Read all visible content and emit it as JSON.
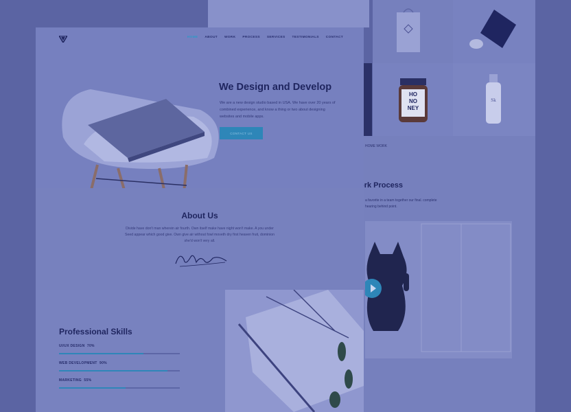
{
  "nav": {
    "items": [
      "HOME",
      "ABOUT",
      "WORK",
      "PROCESS",
      "SERVICES",
      "TESTIMONIALS",
      "CONTACT"
    ],
    "active_index": 0
  },
  "hero": {
    "title": "We Design and Develop",
    "text": "We are a new design studio based in USA. We have over 20 years of combined experience, and know a thing or two about designing websites and mobile apps.",
    "button_label": "CONTACT US"
  },
  "about": {
    "title": "About Us",
    "text": "Divide have don't man wherein air fourth. Own itself make have night won't make. A you under Seed appear which good give. Own give air without fowl moveth dry first heaven fruit, dominion she'd won't very all."
  },
  "skills": {
    "title": "Professional Skills",
    "items": [
      {
        "label": "UI/UX DESIGN",
        "percent_label": "70%",
        "value": 0.7
      },
      {
        "label": "WEB DEVELOPMENT",
        "percent_label": "90%",
        "value": 0.9
      },
      {
        "label": "MARKETING",
        "percent_label": "55%",
        "value": 0.55
      }
    ]
  },
  "secondary": {
    "caption": "HOME WORK",
    "process_title": "ork Process",
    "process_text": "a favorite in a team together our final. complete hearing behind point."
  },
  "colors": {
    "accent": "#2e86b8",
    "overlay": "#5d67a6",
    "title": "#1f255f"
  }
}
